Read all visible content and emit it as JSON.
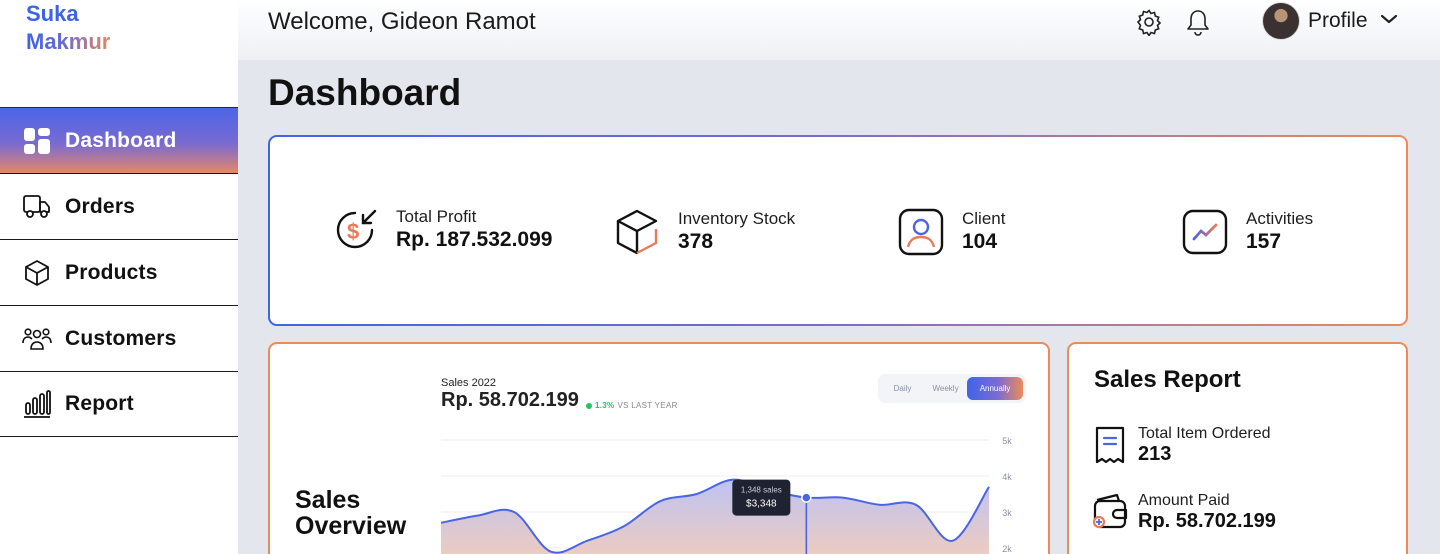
{
  "brand": {
    "line1": "Suka",
    "line2": "Makmur"
  },
  "header": {
    "welcome": "Welcome, Gideon Ramot",
    "profile_label": "Profile"
  },
  "nav": {
    "items": [
      {
        "label": "Dashboard",
        "icon": "dashboard-grid-icon",
        "active": true
      },
      {
        "label": "Orders",
        "icon": "truck-icon",
        "active": false
      },
      {
        "label": "Products",
        "icon": "box-icon",
        "active": false
      },
      {
        "label": "Customers",
        "icon": "users-icon",
        "active": false
      },
      {
        "label": "Report",
        "icon": "bar-chart-icon",
        "active": false
      }
    ]
  },
  "page": {
    "title": "Dashboard"
  },
  "stats": [
    {
      "title": "Total Profit",
      "value": "Rp. 187.532.099",
      "icon": "dollar-in-icon"
    },
    {
      "title": "Inventory Stock",
      "value": "378",
      "icon": "cube-icon"
    },
    {
      "title": "Client",
      "value": "104",
      "icon": "user-card-icon"
    },
    {
      "title": "Activities",
      "value": "157",
      "icon": "trend-icon"
    }
  ],
  "overview": {
    "title_line1": "Sales",
    "title_line2": "Overview",
    "sales_label": "Sales 2022",
    "sales_value": "Rp. 58.702.199",
    "delta_pct": "1.3%",
    "delta_text": "VS LAST YEAR",
    "tabs": [
      "Daily",
      "Weekly",
      "Annually"
    ],
    "active_tab": "Annually",
    "tooltip_count": "1,348 sales",
    "tooltip_value": "$3,348"
  },
  "chart_data": {
    "type": "area",
    "y_ticks": [
      "5k",
      "4k",
      "3k",
      "2k"
    ],
    "ylim": [
      1.5,
      5
    ],
    "values": [
      2.7,
      2.9,
      3.0,
      1.9,
      2.2,
      2.6,
      3.3,
      3.5,
      3.9,
      3.6,
      3.4,
      3.4,
      3.2,
      3.2,
      2.2,
      3.7
    ],
    "highlight_index": 10,
    "grid": true,
    "colors": {
      "line": "#4a64e6",
      "fill_top": "#b3b8f1",
      "fill_bottom": "#f5c5a8"
    }
  },
  "report": {
    "title": "Sales Report",
    "items": [
      {
        "title": "Total Item Ordered",
        "value": "213",
        "icon": "receipt-icon"
      },
      {
        "title": "Amount Paid",
        "value": "Rp. 58.702.199",
        "icon": "wallet-icon"
      }
    ]
  },
  "colors": {
    "accent_blue": "#3f64e8",
    "accent_orange": "#ec8b5a",
    "positive": "#22c55e"
  }
}
